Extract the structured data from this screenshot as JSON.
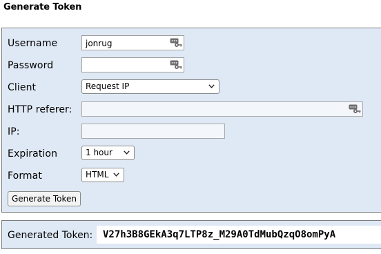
{
  "page": {
    "title": "Generate Token"
  },
  "form": {
    "username": {
      "label": "Username",
      "value": "jonrug"
    },
    "password": {
      "label": "Password",
      "value": ""
    },
    "client": {
      "label": "Client",
      "selected": "Request IP"
    },
    "referer": {
      "label": "HTTP referer:",
      "value": ""
    },
    "ip": {
      "label": "IP:",
      "value": ""
    },
    "expiration": {
      "label": "Expiration",
      "selected": "1 hour"
    },
    "format": {
      "label": "Format",
      "selected": "HTML"
    },
    "submit_label": "Generate Token"
  },
  "result": {
    "label": "Generated Token:",
    "token": "V27h3B8GEkA3q7LTP8z_M29A0TdMubQzqO8omPyA"
  },
  "colors": {
    "panel_bg": "#dfe9f5",
    "panel_border": "#7a7a7a",
    "icon_gray": "#6e6e6e"
  },
  "icons": {
    "password_manager": "password-manager-key-icon",
    "dropdown": "chevron-down-icon"
  }
}
